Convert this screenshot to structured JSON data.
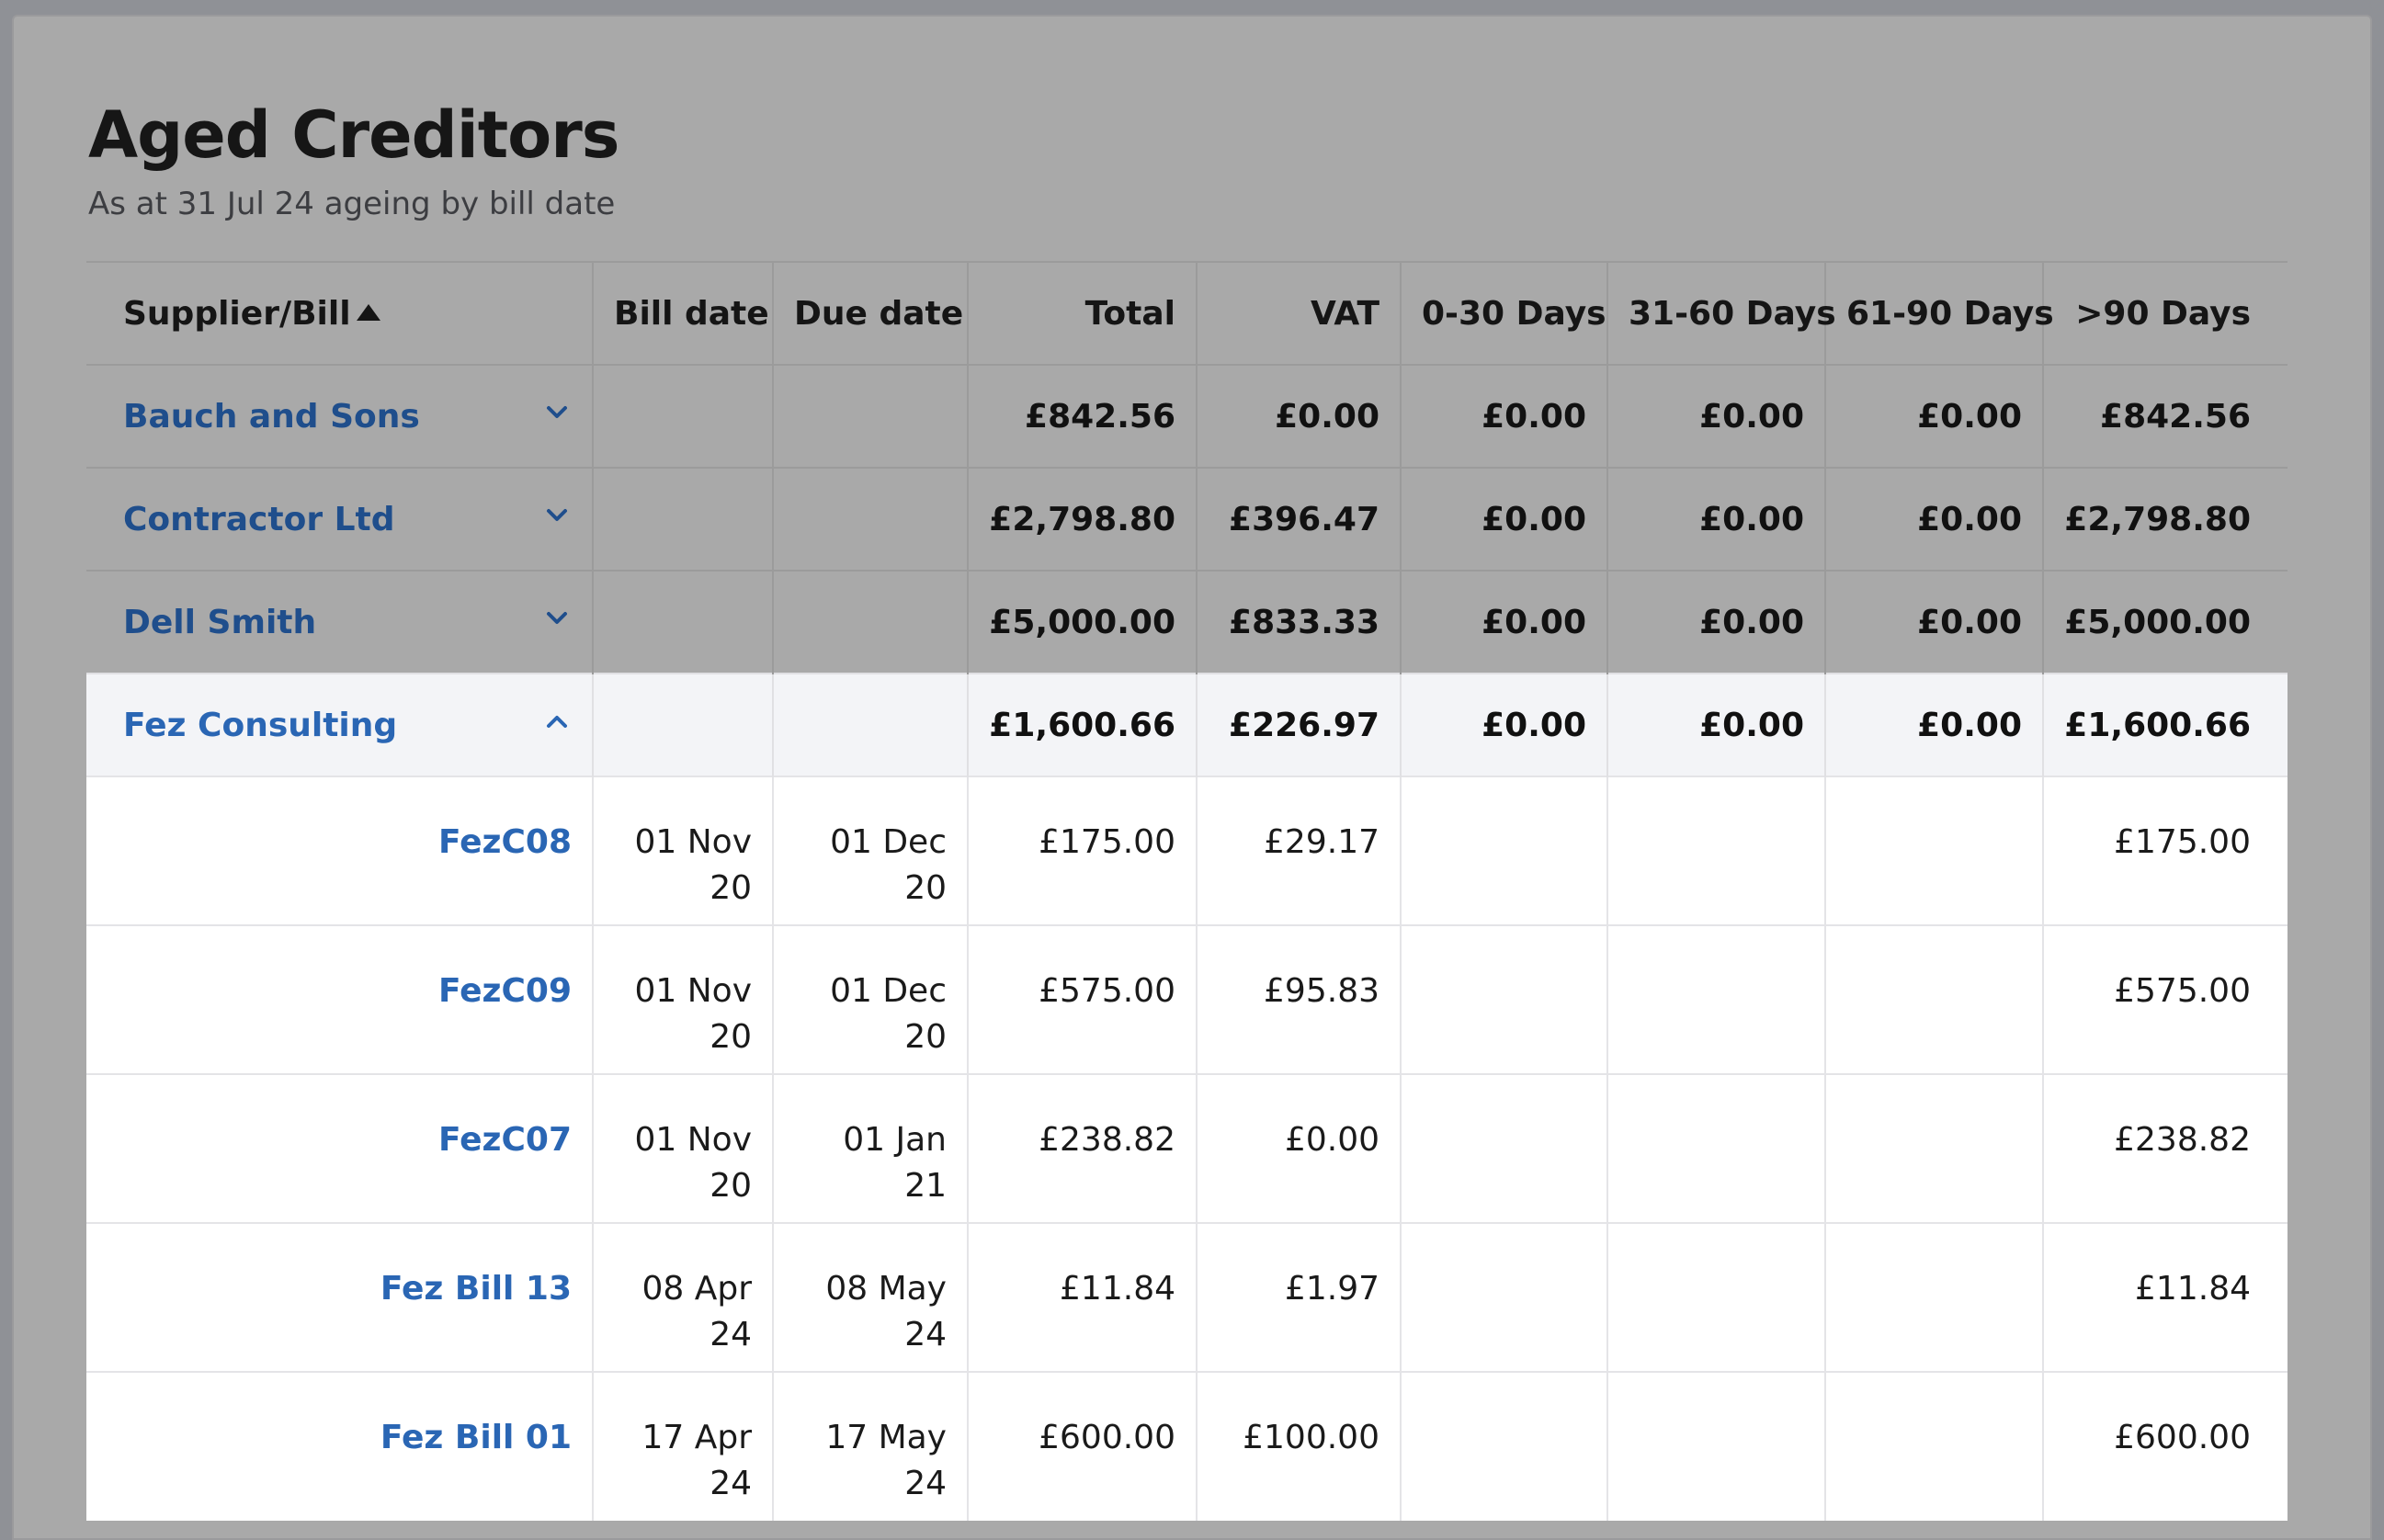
{
  "page": {
    "title": "Aged Creditors",
    "subtitle": "As at 31 Jul 24 ageing by bill date"
  },
  "table": {
    "headers": {
      "supplier_bill": "Supplier/Bill",
      "bill_date": "Bill date",
      "due_date": "Due date",
      "total": "Total",
      "vat": "VAT",
      "d0_30": "0-30 Days",
      "d31_60": "31-60 Days",
      "d61_90": "61-90 Days",
      "d90_plus": ">90 Days"
    },
    "sort": {
      "column": "Supplier/Bill",
      "direction": "ascending"
    },
    "suppliers": [
      {
        "name": "Bauch and Sons",
        "total": "£842.56",
        "vat": "£0.00",
        "d0_30": "£0.00",
        "d31_60": "£0.00",
        "d61_90": "£0.00",
        "d90_plus": "£842.56",
        "expanded": false
      },
      {
        "name": "Contractor Ltd",
        "total": "£2,798.80",
        "vat": "£396.47",
        "d0_30": "£0.00",
        "d31_60": "£0.00",
        "d61_90": "£0.00",
        "d90_plus": "£2,798.80",
        "expanded": false
      },
      {
        "name": "Dell Smith",
        "total": "£5,000.00",
        "vat": "£833.33",
        "d0_30": "£0.00",
        "d31_60": "£0.00",
        "d61_90": "£0.00",
        "d90_plus": "£5,000.00",
        "expanded": false
      },
      {
        "name": "Fez Consulting",
        "total": "£1,600.66",
        "vat": "£226.97",
        "d0_30": "£0.00",
        "d31_60": "£0.00",
        "d61_90": "£0.00",
        "d90_plus": "£1,600.66",
        "expanded": true
      }
    ],
    "bills": [
      {
        "ref": "FezC08",
        "bill_date": [
          "01 Nov",
          "20"
        ],
        "due_date": [
          "01 Dec",
          "20"
        ],
        "total": "£175.00",
        "vat": "£29.17",
        "d90_plus": "£175.00"
      },
      {
        "ref": "FezC09",
        "bill_date": [
          "01 Nov",
          "20"
        ],
        "due_date": [
          "01 Dec",
          "20"
        ],
        "total": "£575.00",
        "vat": "£95.83",
        "d90_plus": "£575.00"
      },
      {
        "ref": "FezC07",
        "bill_date": [
          "01 Nov",
          "20"
        ],
        "due_date": [
          "01 Jan 21"
        ],
        "total": "£238.82",
        "vat": "£0.00",
        "d90_plus": "£238.82"
      },
      {
        "ref": "Fez Bill 13",
        "bill_date": [
          "08 Apr",
          "24"
        ],
        "due_date": [
          "08 May",
          "24"
        ],
        "total": "£11.84",
        "vat": "£1.97",
        "d90_plus": "£11.84"
      },
      {
        "ref": "Fez Bill 01",
        "bill_date": [
          "17 Apr",
          "24"
        ],
        "due_date": [
          "17 May",
          "24"
        ],
        "total": "£600.00",
        "vat": "£100.00",
        "d90_plus": "£600.00"
      }
    ]
  },
  "colors": {
    "overlay": "#a9a9a9",
    "link_blue": "#2a66b4",
    "link_blue_dimmed": "#1f4e8c",
    "expanded_row_bg": "#f3f4f7"
  },
  "icons": {
    "sort": "sort-ascending-icon",
    "collapsed": "chevron-down-icon",
    "expanded": "chevron-up-icon"
  }
}
